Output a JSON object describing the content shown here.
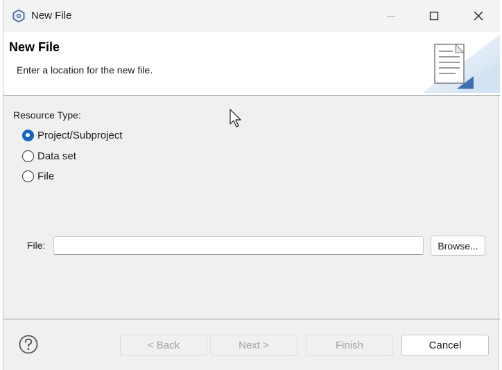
{
  "window": {
    "title": "New File",
    "controls": [
      "minimize-icon",
      "maximize-icon",
      "close-icon"
    ]
  },
  "header": {
    "title": "New File",
    "message": "Enter a location for the new file.",
    "graphic": "new-file-wizard-icon"
  },
  "resource_type": {
    "label": "Resource Type:",
    "options": [
      {
        "label": "Project/Subproject",
        "checked": true
      },
      {
        "label": "Data set",
        "checked": false
      },
      {
        "label": "File",
        "checked": false
      }
    ]
  },
  "file": {
    "label": "File:",
    "value": "",
    "browse_label": "Browse..."
  },
  "footer": {
    "help_icon": "help-icon",
    "back_label": "< Back",
    "next_label": "Next >",
    "finish_label": "Finish",
    "cancel_label": "Cancel"
  },
  "colors": {
    "accent": "#1565c0",
    "background": "#f0f0f0",
    "header_background": "#ffffff"
  }
}
